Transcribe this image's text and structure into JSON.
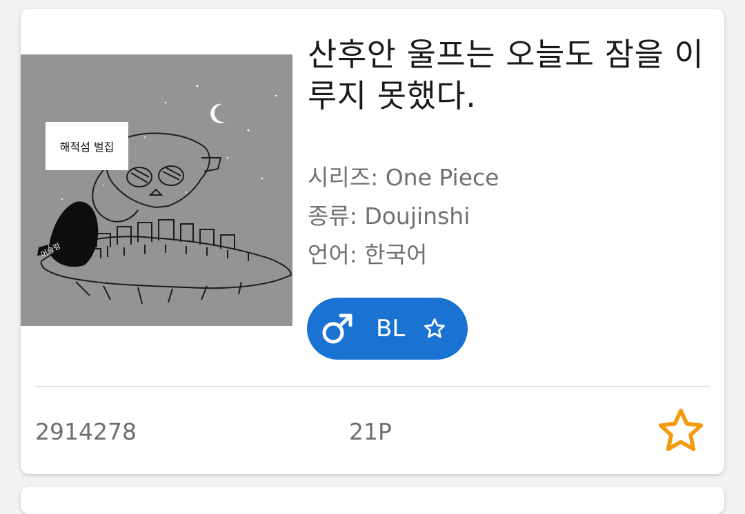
{
  "gallery": {
    "title": "산후안 울프는 오늘도 잠을 이루지 못했다.",
    "cover": {
      "label": "해적섬 벌집",
      "author": "어슬렁",
      "background": "#959495"
    },
    "series": "시리즈: One Piece",
    "type": "종류: Doujinshi",
    "language": "언어: 한국어",
    "tags": [
      {
        "icon": "male-icon",
        "label": "BL",
        "favorite_icon": "star-outline-icon",
        "color": "#1a73d2"
      }
    ],
    "id": "2914278",
    "pages": "21P",
    "favorite_icon": "star-outline-icon",
    "favorite_color": "#f59a0c"
  }
}
